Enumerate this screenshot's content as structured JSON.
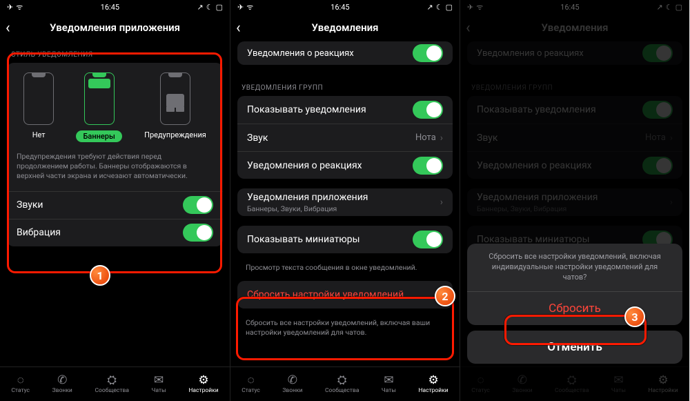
{
  "status": {
    "time": "16:45"
  },
  "screen1": {
    "title": "Уведомления приложения",
    "section_style": "СТИЛЬ УВЕДОМЛЕНИЯ",
    "styles": {
      "none": "Нет",
      "banners": "Баннеры",
      "alerts": "Предупреждения"
    },
    "style_desc": "Предупреждения требуют действия перед продолжением работы. Баннеры отображаются в верхней части экрана и исчезают автоматически.",
    "sounds": "Звуки",
    "vibration": "Вибрация"
  },
  "screen2": {
    "title": "Уведомления",
    "row_reactions_top": "Уведомления о реакциях",
    "section_groups": "УВЕДОМЛЕНИЯ ГРУПП",
    "show_notifications": "Показывать уведомления",
    "sound": "Звук",
    "sound_value": "Нота",
    "reaction_notifications": "Уведомления о реакциях",
    "app_notifications": "Уведомления приложения",
    "app_notifications_sub": "Баннеры, Звуки, Вибрация",
    "show_thumbnails": "Показывать миниатюры",
    "thumbnails_footnote": "Просмотр текста сообщения в окне уведомлений.",
    "reset": "Сбросить настройки уведомлений",
    "reset_footnote": "Сбросить все настройки уведомлений, включая ваши настройки уведомлений для чатов."
  },
  "screen3": {
    "title": "Уведомления",
    "sheet_msg": "Сбросить все настройки уведомлений, включая индивидуальные настройки уведомлений для чатов?",
    "reset_btn": "Сбросить",
    "cancel_btn": "Отменить"
  },
  "tabs": {
    "status": "Статус",
    "calls": "Звонки",
    "communities": "Сообщества",
    "chats": "Чаты",
    "settings": "Настройки"
  },
  "badges": {
    "b1": "1",
    "b2": "2",
    "b3": "3"
  }
}
